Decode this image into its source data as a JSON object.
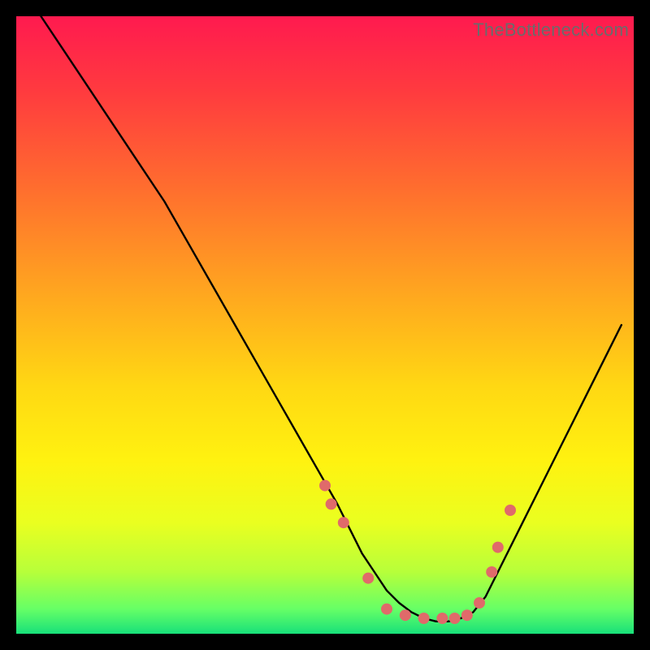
{
  "watermark": "TheBottleneck.com",
  "gradient": {
    "stops": [
      {
        "offset": 0.0,
        "color": "#ff1a4f"
      },
      {
        "offset": 0.12,
        "color": "#ff3a3f"
      },
      {
        "offset": 0.28,
        "color": "#ff6e2e"
      },
      {
        "offset": 0.45,
        "color": "#ffa71f"
      },
      {
        "offset": 0.6,
        "color": "#ffd813"
      },
      {
        "offset": 0.72,
        "color": "#fff210"
      },
      {
        "offset": 0.82,
        "color": "#eaff20"
      },
      {
        "offset": 0.9,
        "color": "#b7ff3a"
      },
      {
        "offset": 0.96,
        "color": "#66ff66"
      },
      {
        "offset": 1.0,
        "color": "#18e07a"
      }
    ]
  },
  "chart_data": {
    "type": "line",
    "title": "",
    "xlabel": "",
    "ylabel": "",
    "xlim": [
      0,
      100
    ],
    "ylim": [
      0,
      100
    ],
    "series": [
      {
        "name": "curve",
        "x": [
          4,
          8,
          12,
          16,
          20,
          24,
          28,
          32,
          36,
          40,
          44,
          48,
          52,
          54,
          56,
          58,
          60,
          62,
          64,
          66,
          68,
          70,
          72,
          74,
          76,
          78,
          82,
          86,
          90,
          94,
          98
        ],
        "y": [
          100,
          94,
          88,
          82,
          76,
          70,
          63,
          56,
          49,
          42,
          35,
          28,
          21,
          17,
          13,
          10,
          7,
          5,
          3.5,
          2.5,
          2,
          2,
          2.5,
          3.5,
          6,
          10,
          18,
          26,
          34,
          42,
          50
        ]
      }
    ],
    "markers": {
      "name": "dots",
      "x": [
        50,
        51,
        53,
        57,
        60,
        63,
        66,
        69,
        71,
        73,
        75,
        77,
        78,
        80
      ],
      "y": [
        24,
        21,
        18,
        9,
        4,
        3,
        2.5,
        2.5,
        2.5,
        3,
        5,
        10,
        14,
        20
      ],
      "color": "#e06a6a",
      "radius": 7
    }
  }
}
